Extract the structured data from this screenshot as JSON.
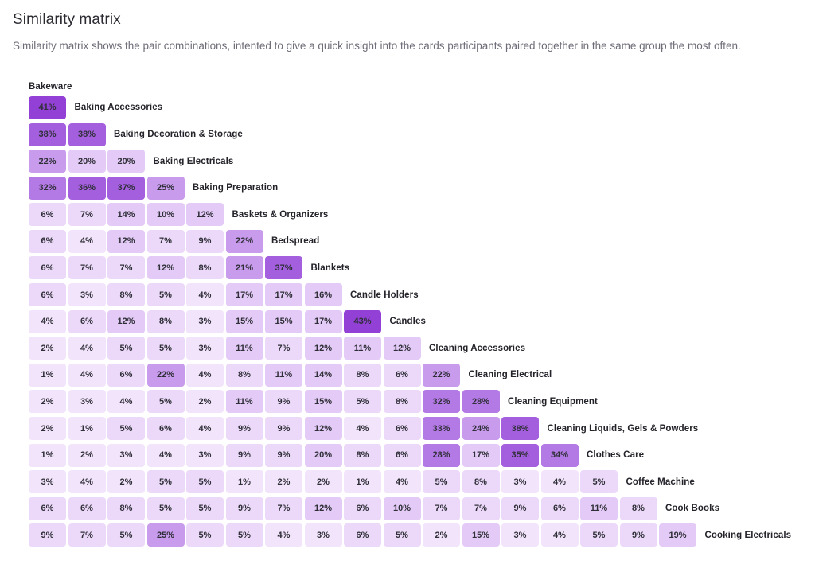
{
  "header": {
    "title": "Similarity matrix",
    "description": "Similarity matrix shows the pair combinations, intented to give a quick insight into the cards participants paired together in the same group the most often."
  },
  "chart_data": {
    "type": "heatmap",
    "title": "Similarity matrix",
    "subtitle": "Similarity matrix shows the pair combinations, intented to give a quick insight into the cards participants paired together in the same group the most often.",
    "value_unit": "%",
    "triangular": "lower",
    "corner_label": "Bakeware",
    "categories": [
      "Bakeware",
      "Baking Accessories",
      "Baking Decoration & Storage",
      "Baking Electricals",
      "Baking Preparation",
      "Baskets & Organizers",
      "Bedspread",
      "Blankets",
      "Candle Holders",
      "Candles",
      "Cleaning Accessories",
      "Cleaning Electrical",
      "Cleaning Equipment",
      "Cleaning Liquids, Gels & Powders",
      "Clothes Care",
      "Coffee Machine",
      "Cook Books",
      "Cooking Electricals"
    ],
    "color_scale": {
      "legend_position": "none",
      "tiers": [
        {
          "max": 4,
          "color": "#f2e4fb"
        },
        {
          "max": 9,
          "color": "#ecd9f9"
        },
        {
          "max": 20,
          "color": "#e4cbf7"
        },
        {
          "max": 26,
          "color": "#c89bec"
        },
        {
          "max": 34,
          "color": "#b379e4"
        },
        {
          "max": 39,
          "color": "#a45fdf"
        },
        {
          "max": 100,
          "color": "#9340d6"
        }
      ]
    },
    "rows": [
      {
        "label": "Baking Accessories",
        "values": [
          41
        ]
      },
      {
        "label": "Baking Decoration & Storage",
        "values": [
          38,
          38
        ]
      },
      {
        "label": "Baking Electricals",
        "values": [
          22,
          20,
          20
        ]
      },
      {
        "label": "Baking Preparation",
        "values": [
          32,
          36,
          37,
          25
        ]
      },
      {
        "label": "Baskets & Organizers",
        "values": [
          6,
          7,
          14,
          10,
          12
        ]
      },
      {
        "label": "Bedspread",
        "values": [
          6,
          4,
          12,
          7,
          9,
          22
        ]
      },
      {
        "label": "Blankets",
        "values": [
          6,
          7,
          7,
          12,
          8,
          21,
          37
        ]
      },
      {
        "label": "Candle Holders",
        "values": [
          6,
          3,
          8,
          5,
          4,
          17,
          17,
          16
        ]
      },
      {
        "label": "Candles",
        "values": [
          4,
          6,
          12,
          8,
          3,
          15,
          15,
          17,
          43
        ]
      },
      {
        "label": "Cleaning Accessories",
        "values": [
          2,
          4,
          5,
          5,
          3,
          11,
          7,
          12,
          11,
          12
        ]
      },
      {
        "label": "Cleaning Electrical",
        "values": [
          1,
          4,
          6,
          22,
          4,
          8,
          11,
          14,
          8,
          6,
          22
        ]
      },
      {
        "label": "Cleaning Equipment",
        "values": [
          2,
          3,
          4,
          5,
          2,
          11,
          9,
          15,
          5,
          8,
          32,
          28
        ]
      },
      {
        "label": "Cleaning Liquids, Gels & Powders",
        "values": [
          2,
          1,
          5,
          6,
          4,
          9,
          9,
          12,
          4,
          6,
          33,
          24,
          38
        ]
      },
      {
        "label": "Clothes Care",
        "values": [
          1,
          2,
          3,
          4,
          3,
          9,
          9,
          20,
          8,
          6,
          28,
          17,
          35,
          34
        ]
      },
      {
        "label": "Coffee Machine",
        "values": [
          3,
          4,
          2,
          5,
          5,
          1,
          2,
          2,
          1,
          4,
          5,
          8,
          3,
          4,
          5
        ]
      },
      {
        "label": "Cook Books",
        "values": [
          6,
          6,
          8,
          5,
          5,
          9,
          7,
          12,
          6,
          10,
          7,
          7,
          9,
          6,
          11,
          8
        ]
      },
      {
        "label": "Cooking Electricals",
        "values": [
          9,
          7,
          5,
          25,
          5,
          5,
          4,
          3,
          6,
          5,
          2,
          15,
          3,
          4,
          5,
          9,
          19
        ]
      }
    ]
  }
}
